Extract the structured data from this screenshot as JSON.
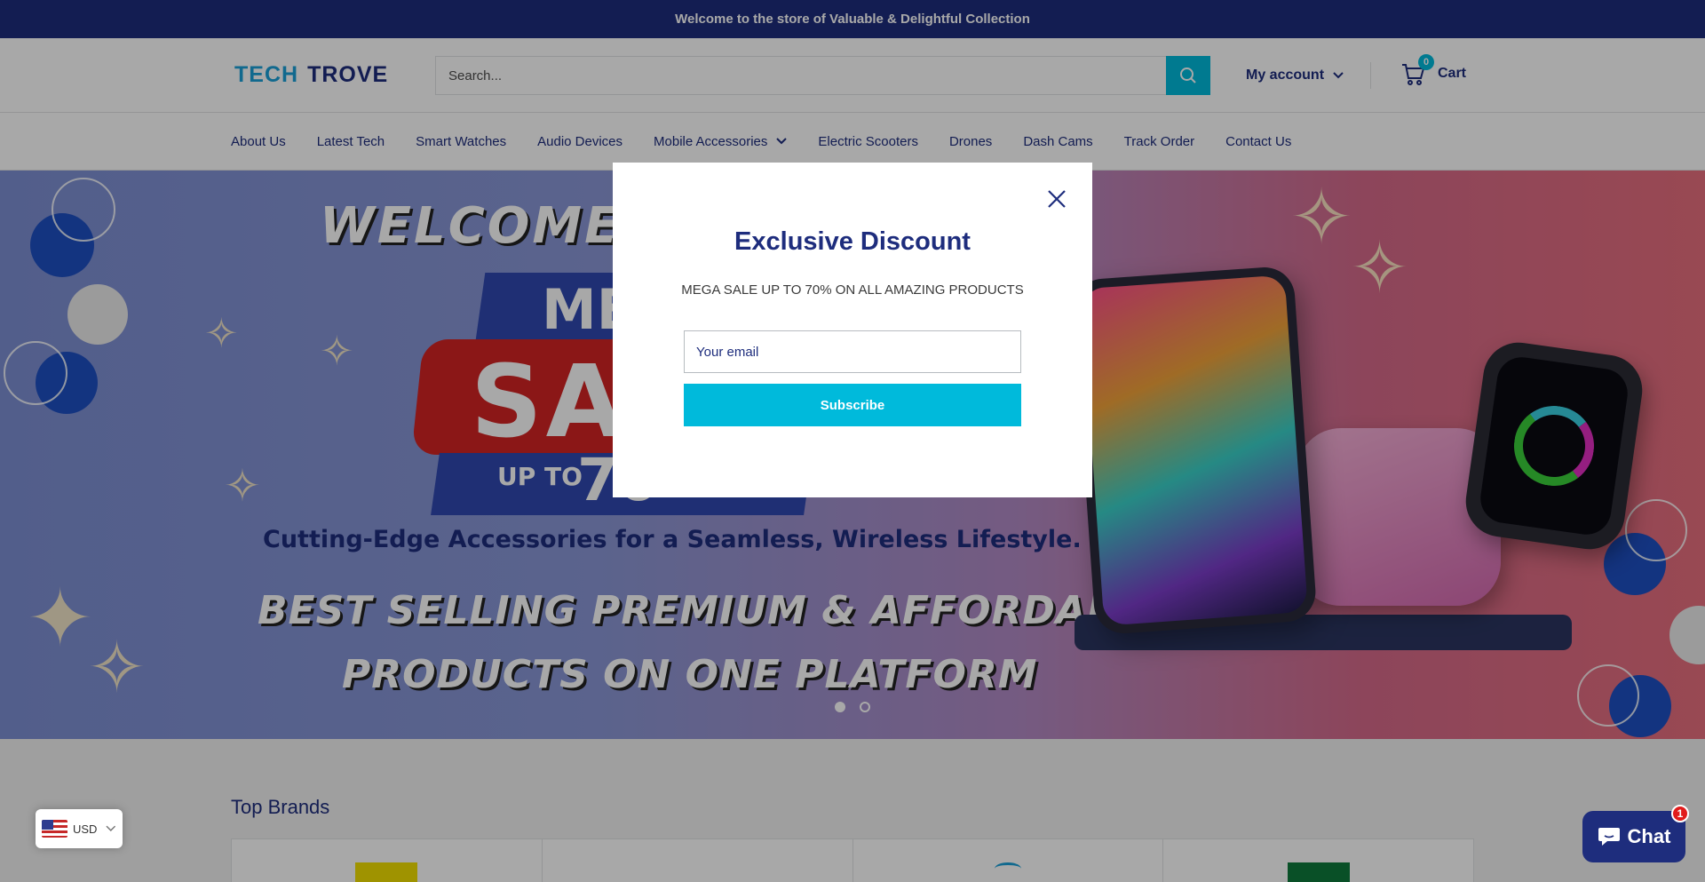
{
  "announcement": "Welcome to the store of Valuable & Delightful Collection",
  "header": {
    "logo_part1": "TECH",
    "logo_part2": "TROVE",
    "search_placeholder": "Search...",
    "account_label": "My account",
    "cart_label": "Cart",
    "cart_count": "0"
  },
  "nav": {
    "items": [
      {
        "label": "About Us"
      },
      {
        "label": "Latest Tech"
      },
      {
        "label": "Smart Watches"
      },
      {
        "label": "Audio Devices"
      },
      {
        "label": "Mobile Accessories"
      },
      {
        "label": "Electric Scooters"
      },
      {
        "label": "Drones"
      },
      {
        "label": "Dash Cams"
      },
      {
        "label": "Track Order"
      },
      {
        "label": "Contact Us"
      }
    ]
  },
  "hero": {
    "title": "WELCOME TO",
    "mega": "ME",
    "sale": "SA",
    "upto": "UP TO",
    "upto_num": "70",
    "subtitle": "Cutting-Edge Accessories for a Seamless, Wireless Lifestyle.",
    "line1": "BEST SELLING PREMIUM & AFFORDABLE",
    "line2": "PRODUCTS ON ONE PLATFORM",
    "slides_total": 2,
    "active_slide": 1
  },
  "brands": {
    "title": "Top Brands"
  },
  "modal": {
    "title": "Exclusive Discount",
    "text": "MEGA SALE UP TO 70% ON ALL AMAZING PRODUCTS",
    "email_placeholder": "Your email",
    "subscribe_label": "Subscribe"
  },
  "currency": {
    "code": "USD"
  },
  "chat": {
    "label": "Chat",
    "badge": "1"
  },
  "colors": {
    "brand_navy": "#1e2d7d",
    "accent_cyan": "#00badb",
    "badge_red": "#e11b1b"
  }
}
